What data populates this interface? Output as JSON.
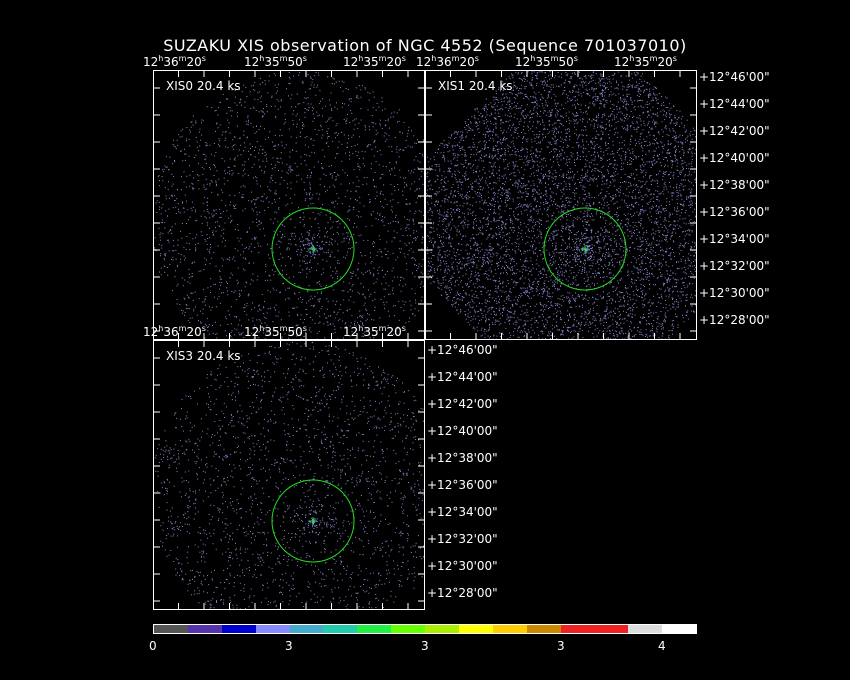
{
  "title": "SUZAKU XIS observation of NGC 4552  (Sequence 701037010)",
  "panels": [
    {
      "label": "XIS0 20.4 ks"
    },
    {
      "label": "XIS1 20.4 ks"
    },
    {
      "label": "XIS3 20.4 ks"
    }
  ],
  "ra_ticks_top_left": [
    "12h36m20s",
    "12h35m50s",
    "12h35m20s"
  ],
  "ra_ticks_top_right": [
    "12h36m20s",
    "12h35m50s",
    "12h35m20s"
  ],
  "ra_ticks_bottom_left": [
    "12h36m20s",
    "12h35m50s",
    "12h35m20s"
  ],
  "dec_ticks": [
    "+12°46'00\"",
    "+12°44'00\"",
    "+12°42'00\"",
    "+12°40'00\"",
    "+12°38'00\"",
    "+12°36'00\"",
    "+12°34'00\"",
    "+12°32'00\"",
    "+12°30'00\"",
    "+12°28'00\""
  ],
  "colorbar": {
    "colors": [
      "#555555",
      "#5533aa",
      "#0000cc",
      "#8888ff",
      "#44aacc",
      "#22ccaa",
      "#22ee44",
      "#66ff00",
      "#aaee00",
      "#ffff00",
      "#ffcc00",
      "#cc8800",
      "#ee2222",
      "#ee2222",
      "#dddddd",
      "#ffffff"
    ],
    "labels": [
      "0",
      "3",
      "3",
      "3",
      "4"
    ]
  },
  "colors": {
    "circle": "#22dd22",
    "points": "#8888cc"
  }
}
